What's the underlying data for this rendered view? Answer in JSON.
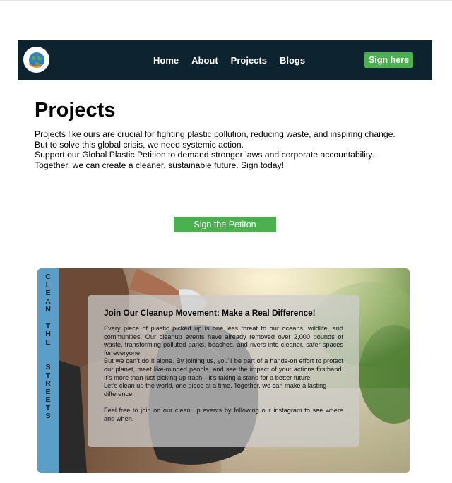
{
  "nav": {
    "logo_icon": "globe-logo-icon",
    "links": [
      "Home",
      "About",
      "Projects",
      "Blogs"
    ],
    "cta": "Sign here"
  },
  "hero": {
    "title": "Projects",
    "line1": "Projects like ours are crucial for fighting plastic pollution, reducing waste, and inspiring change.",
    "line2": "But to solve this global crisis, we need systemic action.",
    "line3": "Support our Global Plastic Petition to demand stronger laws and corporate accountability.",
    "line4": "Together, we can create a cleaner, sustainable future. Sign today!",
    "button": "Sign the Petiton"
  },
  "banner": {
    "side_words": [
      "CLEAN",
      "THE",
      "STREETS"
    ],
    "heading": "Join Our Cleanup Movement: Make a Real Difference!",
    "para1": "Every piece of plastic picked up is one less threat to our oceans, wildlife, and communities. Our cleanup events have already removed over 2,000 pounds of waste, transforming polluted parks, beaches, and rivers into cleaner, safer spaces for everyone.",
    "para2": "But we can’t do it alone. By joining us, you’ll be part of a hands-on effort to protect our planet, meet like-minded people, and see the impact of your actions firsthand. It’s more than just picking up trash—it’s taking a stand for a better future.",
    "para3": "Let’s clean up the world, one piece at a time. Together, we can make a lasting difference!",
    "para4": "Feel free to join on our clean up events by following our instagram to see where and when."
  },
  "colors": {
    "nav_bg": "#0d2330",
    "accent_green": "#4caf50",
    "strip_blue": "#5b9ec8"
  }
}
